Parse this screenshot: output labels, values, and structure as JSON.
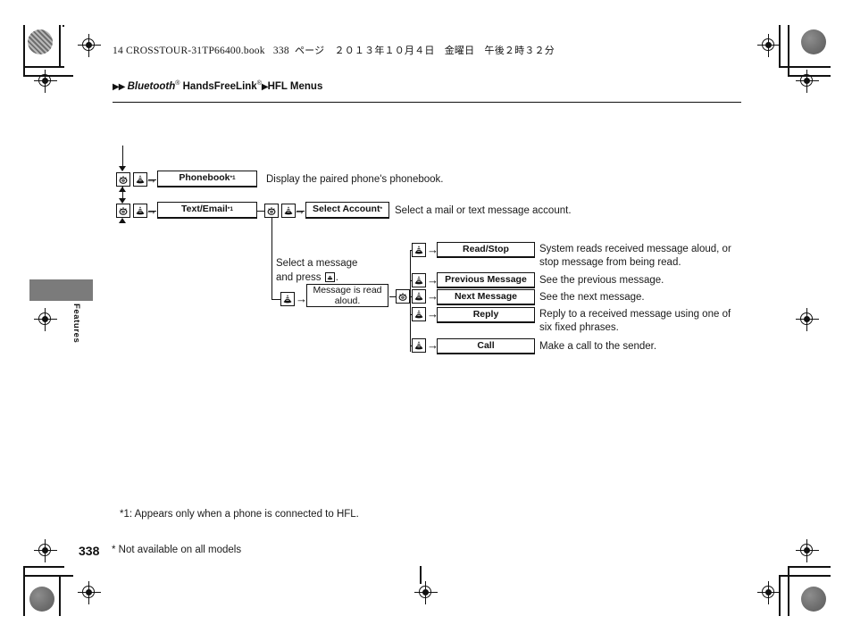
{
  "document": {
    "file_header": "14 CROSSTOUR-31TP66400.book",
    "file_header_page": "338",
    "file_header_jp": "ページ　２０１３年１０月４日　金曜日　午後２時３２分",
    "breadcrumb_1": "Bluetooth",
    "breadcrumb_1_sup": "®",
    "breadcrumb_2": "HandsFreeLink",
    "breadcrumb_2_sup": "®",
    "breadcrumb_3": "HFL Menus",
    "side_tab_label": "Features",
    "page_number": "338",
    "footnote_1": "*1: Appears only when a phone is connected to HFL.",
    "footnote_2": "* Not available on all models"
  },
  "diagram": {
    "rows": [
      {
        "label": "Phonebook",
        "sup": "*1",
        "description": "Display the paired phone's phonebook."
      },
      {
        "label": "Text/Email",
        "sup": "*1",
        "description": ""
      }
    ],
    "select_account": {
      "label": "Select Account",
      "sup": "*",
      "description": "Select a mail or text message account."
    },
    "instruction": {
      "line1": "Select a message",
      "line2_pre": "and press",
      "line2_post": "."
    },
    "message_box": {
      "line1": "Message is read",
      "line2": "aloud."
    },
    "submenu": [
      {
        "label": "Read/Stop",
        "description_line1": "System reads received message aloud, or",
        "description_line2": "stop message from being read."
      },
      {
        "label": "Previous Message",
        "description_line1": "See the previous message.",
        "description_line2": ""
      },
      {
        "label": "Next Message",
        "description_line1": "See the next message.",
        "description_line2": ""
      },
      {
        "label": "Reply",
        "description_line1": "Reply to a received message using one of",
        "description_line2": "six fixed phrases."
      },
      {
        "label": "Call",
        "description_line1": "Make a call to the sender.",
        "description_line2": ""
      }
    ],
    "icons": {
      "dial": "rotary-dial-icon",
      "press": "press-button-icon",
      "arrow": "→"
    }
  }
}
